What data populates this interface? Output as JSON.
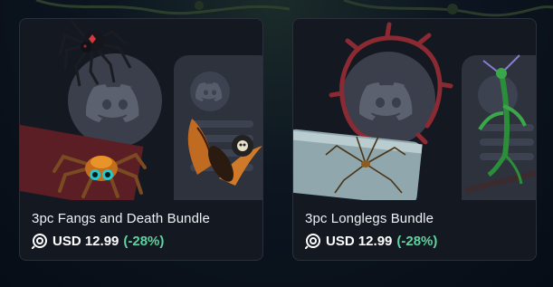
{
  "products": [
    {
      "name": "3pc Fangs and Death Bundle",
      "price": "USD 12.99",
      "discount": "(-28%)",
      "icons": [
        "spider-icon",
        "discord-logo-icon",
        "jumping-spider-icon",
        "moth-skull-icon"
      ]
    },
    {
      "name": "3pc Longlegs Bundle",
      "price": "USD 12.99",
      "discount": "(-28%)",
      "icons": [
        "thorn-vine-ring-icon",
        "discord-logo-icon",
        "daddy-longlegs-icon",
        "praying-mantis-icon"
      ]
    }
  ],
  "colors": {
    "card_bg": "#141821",
    "price": "#ffffff",
    "discount": "#5fd3a0",
    "title": "#eef0f3"
  }
}
